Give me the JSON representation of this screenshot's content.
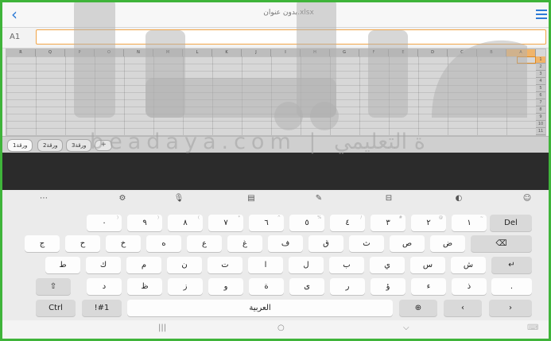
{
  "titlebar": {
    "title": "بدون عنوان.xlsx"
  },
  "formula_bar": {
    "cell_ref": "A1",
    "value": ""
  },
  "grid": {
    "columns": [
      "R",
      "Q",
      "P",
      "O",
      "N",
      "M",
      "L",
      "K",
      "J",
      "I",
      "H",
      "G",
      "F",
      "E",
      "D",
      "C",
      "B",
      "A"
    ],
    "selected_column": "A",
    "rows": [
      "1",
      "2",
      "3",
      "4",
      "5",
      "6",
      "7",
      "8",
      "9",
      "10",
      "11"
    ],
    "selected_row": "1"
  },
  "sheet_tabs": [
    {
      "label": "ورقة1",
      "active": true
    },
    {
      "label": "ورقة2",
      "active": false
    },
    {
      "label": "ورقة3",
      "active": false
    }
  ],
  "sheet_add_label": "+",
  "keyboard": {
    "toolbar_icons": [
      "more-icon",
      "settings-icon",
      "mic-icon",
      "clipboard-icon",
      "handwriting-icon",
      "keyboard-resize-icon",
      "sticker-icon",
      "emoji-icon"
    ],
    "rows": [
      [
        "١",
        "٢",
        "٣",
        "٤",
        "٥",
        "٦",
        "٧",
        "٨",
        "٩",
        "٠"
      ],
      [
        "ض",
        "ص",
        "ث",
        "ق",
        "ف",
        "غ",
        "ع",
        "ه",
        "خ",
        "ح",
        "ج"
      ],
      [
        "ش",
        "س",
        "ي",
        "ب",
        "ل",
        "ا",
        "ت",
        "ن",
        "م",
        "ك",
        "ط"
      ],
      [
        "ذ",
        "ء",
        "ؤ",
        "ر",
        "ى",
        "ة",
        "و",
        "ز",
        "ظ",
        "د",
        "؟"
      ]
    ],
    "row1_subs": [
      "~",
      "@",
      "#",
      "/",
      "%",
      "^",
      "*",
      "(",
      ")",
      ")"
    ],
    "del_label": "Del",
    "ctrl_label": "Ctrl",
    "sym_label": "!#1",
    "space_label": "العربية",
    "period_label": "."
  },
  "navbar": {
    "recent": "|||",
    "home": "○",
    "back": "⌵",
    "keyboard": "⌨"
  },
  "watermark": "beadaya.com | ة التعليمي"
}
